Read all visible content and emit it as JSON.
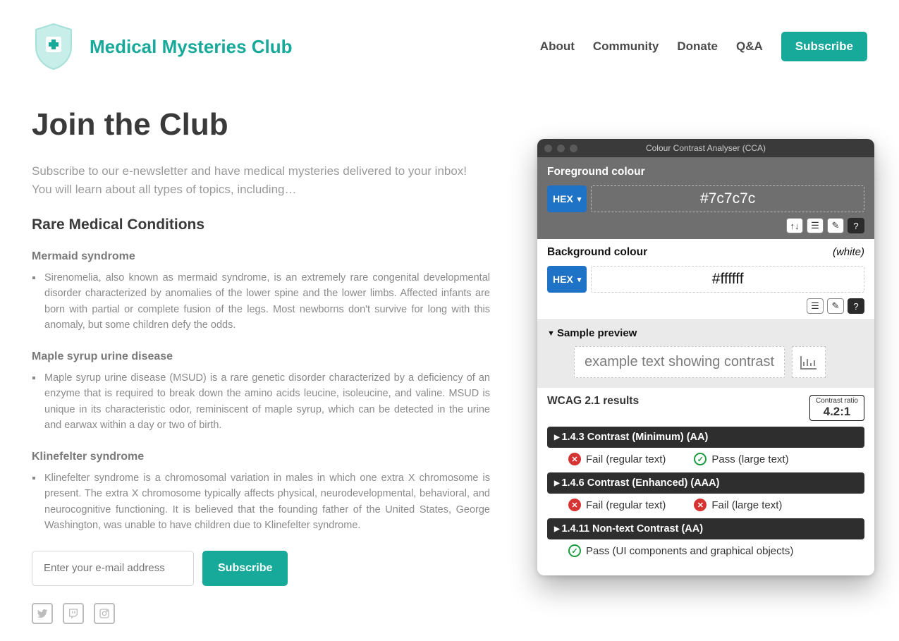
{
  "header": {
    "brand": "Medical Mysteries Club",
    "nav": [
      "About",
      "Community",
      "Donate",
      "Q&A"
    ],
    "subscribe": "Subscribe"
  },
  "main": {
    "title": "Join the Club",
    "intro": "Subscribe to our e-newsletter and have medical mysteries delivered to your inbox! You will learn about all types of topics, including…",
    "section": "Rare Medical Conditions",
    "conditions": [
      {
        "name": "Mermaid syndrome",
        "body": "Sirenomelia, also known as mermaid syndrome, is an extremely rare congenital developmental disorder characterized by anomalies of the lower spine and the lower limbs. Affected infants are born with partial or complete fusion of the legs. Most newborns don't survive for long with this anomaly, but some children defy the odds."
      },
      {
        "name": "Maple syrup urine disease",
        "body": "Maple syrup urine disease (MSUD) is a rare genetic disorder characterized by a deficiency of an enzyme that is required to break down the amino acids leucine, isoleucine, and valine. MSUD is unique in its characteristic odor, reminiscent of maple syrup, which can be detected in the urine and earwax within a day or two of birth."
      },
      {
        "name": "Klinefelter syndrome",
        "body": "Klinefelter syndrome is a chromosomal variation in males in which one extra X chromosome is present. The extra X chromosome typically affects physical, neurodevelopmental, behavioral, and neurocognitive functioning. It is believed that the founding father of the United States, George Washington, was unable to have children due to Klinefelter syndrome."
      }
    ],
    "email_placeholder": "Enter your e-mail address",
    "subscribe": "Subscribe"
  },
  "cca": {
    "title": "Colour Contrast Analyser (CCA)",
    "foreground_label": "Foreground colour",
    "background_label": "Background colour",
    "hex_label": "HEX",
    "foreground_value": "#7c7c7c",
    "background_value": "#ffffff",
    "white_note": "(white)",
    "sample_header": "Sample preview",
    "sample_text": "example text showing contrast",
    "results_title": "WCAG 2.1 results",
    "ratio_label": "Contrast ratio",
    "ratio_value": "4.2:1",
    "bars": [
      "1.4.3 Contrast (Minimum) (AA)",
      "1.4.6 Contrast (Enhanced) (AAA)",
      "1.4.11 Non-text Contrast (AA)"
    ],
    "fail_regular": "Fail (regular text)",
    "pass_large": "Pass (large text)",
    "fail_large": "Fail (large text)",
    "pass_ui": "Pass (UI components and graphical objects)"
  }
}
